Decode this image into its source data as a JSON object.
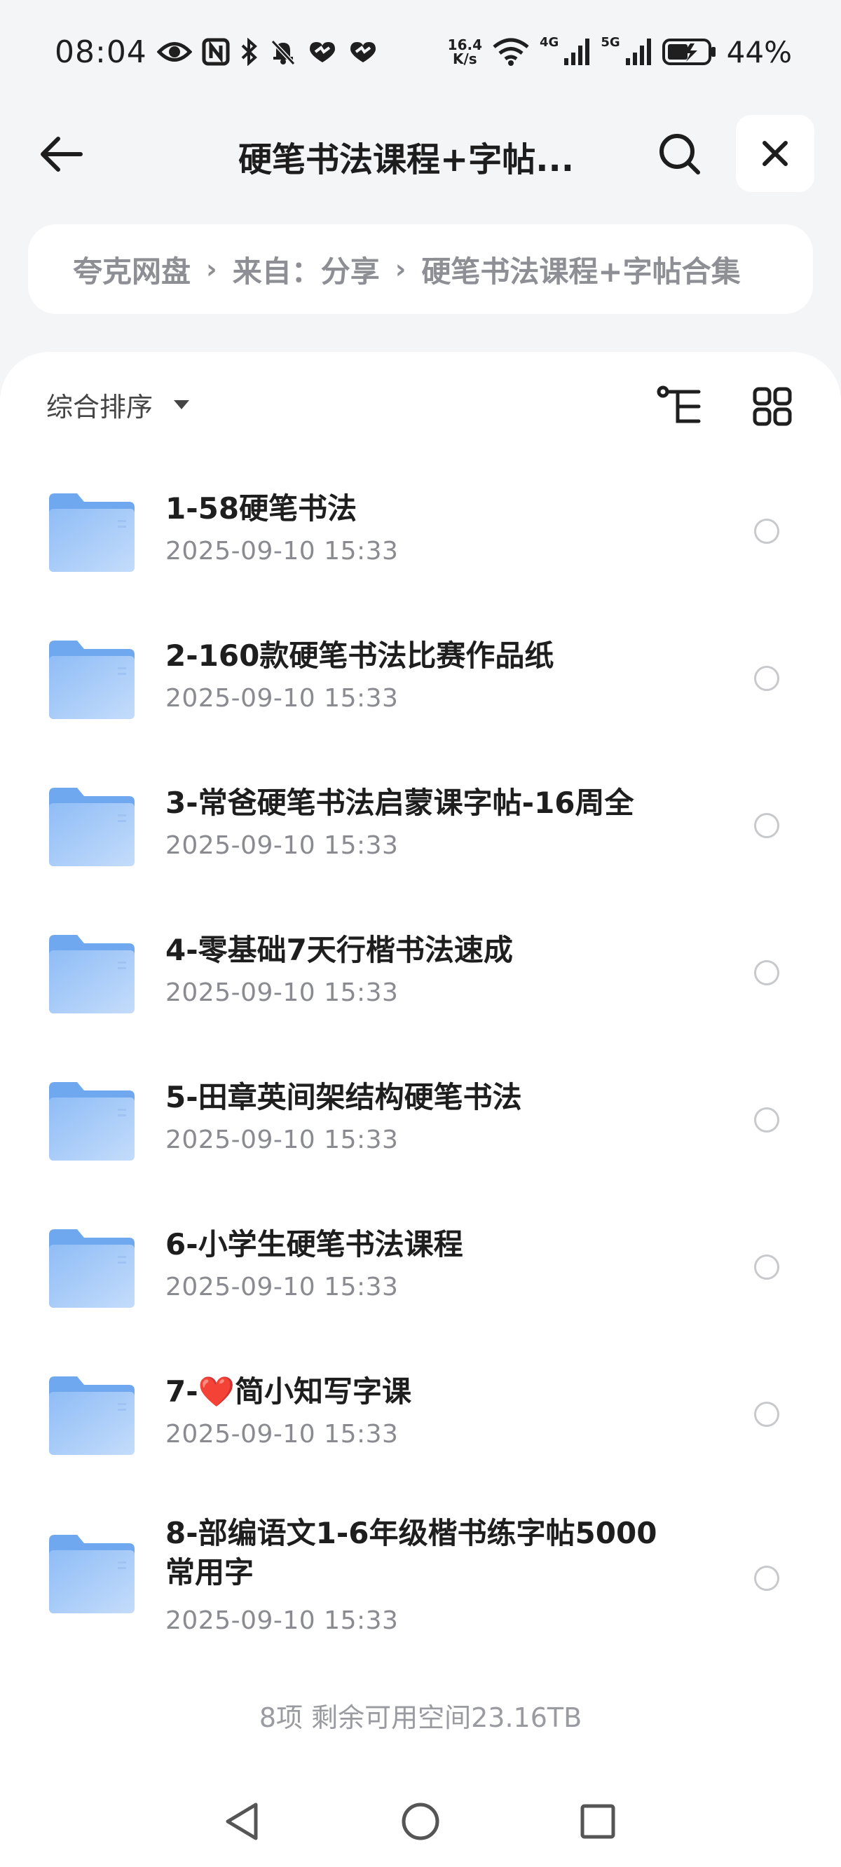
{
  "status_bar": {
    "time": "08:04",
    "net_speed_value": "16.4",
    "net_speed_unit": "K/s",
    "sig1_label": "4G",
    "sig2_label": "5G",
    "battery": "44%"
  },
  "header": {
    "title": "硬笔书法课程+字帖..."
  },
  "breadcrumb": {
    "items": [
      "夸克网盘",
      "来自：分享",
      "硬笔书法课程+字帖合集"
    ]
  },
  "toolbar": {
    "sort_label": "综合排序"
  },
  "files": [
    {
      "name": "1-58硬笔书法",
      "date": "2025-09-10 15:33"
    },
    {
      "name": "2-160款硬笔书法比赛作品纸",
      "date": "2025-09-10 15:33"
    },
    {
      "name": "3-常爸硬笔书法启蒙课字帖-16周全",
      "date": "2025-09-10 15:33"
    },
    {
      "name": "4-零基础7天行楷书法速成",
      "date": "2025-09-10 15:33"
    },
    {
      "name": "5-田章英间架结构硬笔书法",
      "date": "2025-09-10 15:33"
    },
    {
      "name": "6-小学生硬笔书法课程",
      "date": "2025-09-10 15:33"
    },
    {
      "name": "7-❤️简小知写字课",
      "date": "2025-09-10 15:33"
    },
    {
      "name": "8-部编语文1-6年级楷书练字帖5000常用字",
      "date": "2025-09-10 15:33"
    }
  ],
  "footer": {
    "summary": "8项 剩余可用空间23.16TB"
  },
  "colors": {
    "folder_light": "#bcd8fb",
    "folder_dark": "#6fa8ef",
    "accent": "#1d1d1d"
  }
}
